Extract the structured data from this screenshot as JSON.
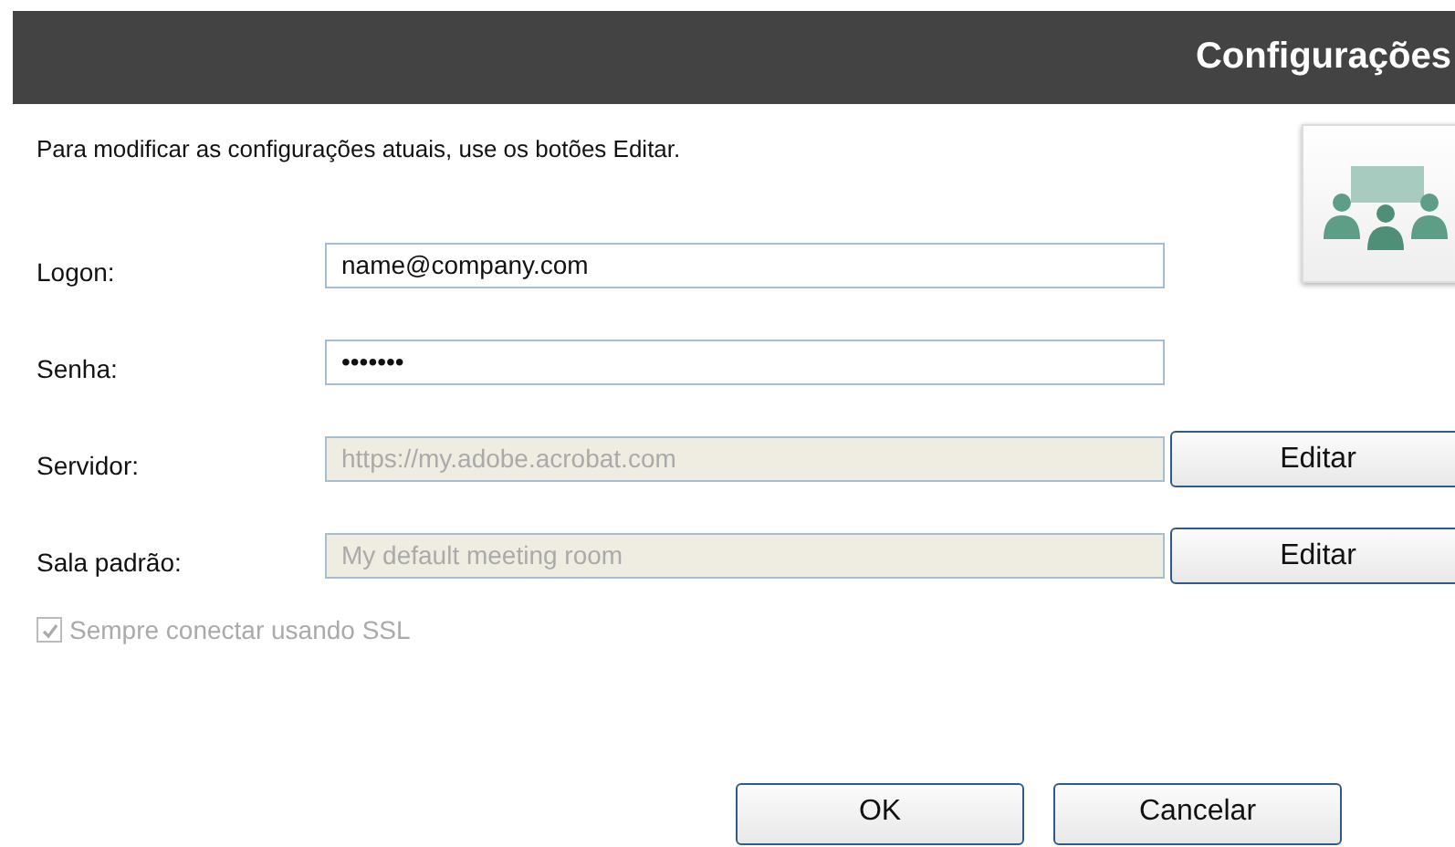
{
  "header": {
    "title": "Configurações"
  },
  "instructions": "Para modificar as configurações atuais, use os botões Editar.",
  "fields": [
    {
      "label": "Logon:",
      "value": "name@company.com",
      "disabled": false
    },
    {
      "label": "Senha:",
      "value": "•••••••",
      "disabled": false
    },
    {
      "label": "Servidor:",
      "value": "https://my.adobe.acrobat.com",
      "disabled": true,
      "button": "Editar"
    },
    {
      "label": "Sala padrão:",
      "value": "My default meeting room",
      "disabled": true,
      "button": "Editar"
    }
  ],
  "ssl": {
    "label": "Sempre conectar usando SSL",
    "checked": true,
    "disabled": true
  },
  "buttons": [
    "OK",
    "Cancelar"
  ]
}
